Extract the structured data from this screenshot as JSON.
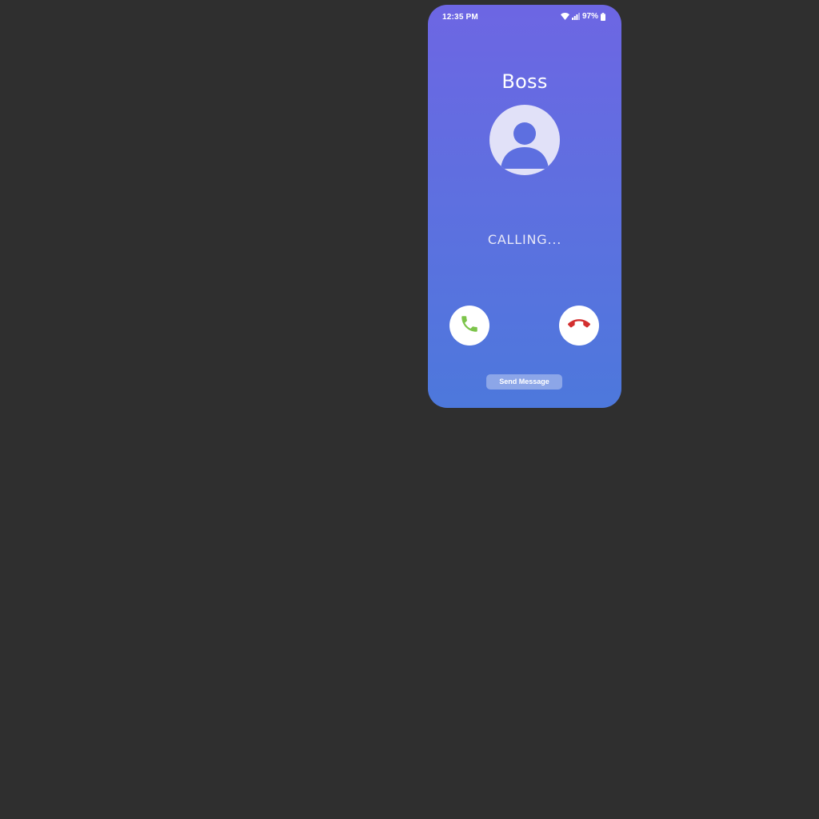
{
  "status_bar": {
    "time": "12:35 PM",
    "battery_percent": "97%",
    "icons": [
      "wifi-icon",
      "signal-icon",
      "battery-icon"
    ]
  },
  "call": {
    "caller_name": "Boss",
    "status": "CALLING...",
    "avatar_icon": "person-avatar-icon"
  },
  "actions": {
    "accept_icon": "phone-accept-icon",
    "decline_icon": "phone-decline-icon",
    "send_message_label": "Send Message"
  },
  "colors": {
    "background": "#2f2f2f",
    "gradient_top": "#6d66e3",
    "gradient_bottom": "#4d78dc",
    "accept": "#7cc44a",
    "decline": "#d32f2f",
    "avatar_bg": "#e1e1f8",
    "avatar_fg": "#5d6fe0"
  }
}
